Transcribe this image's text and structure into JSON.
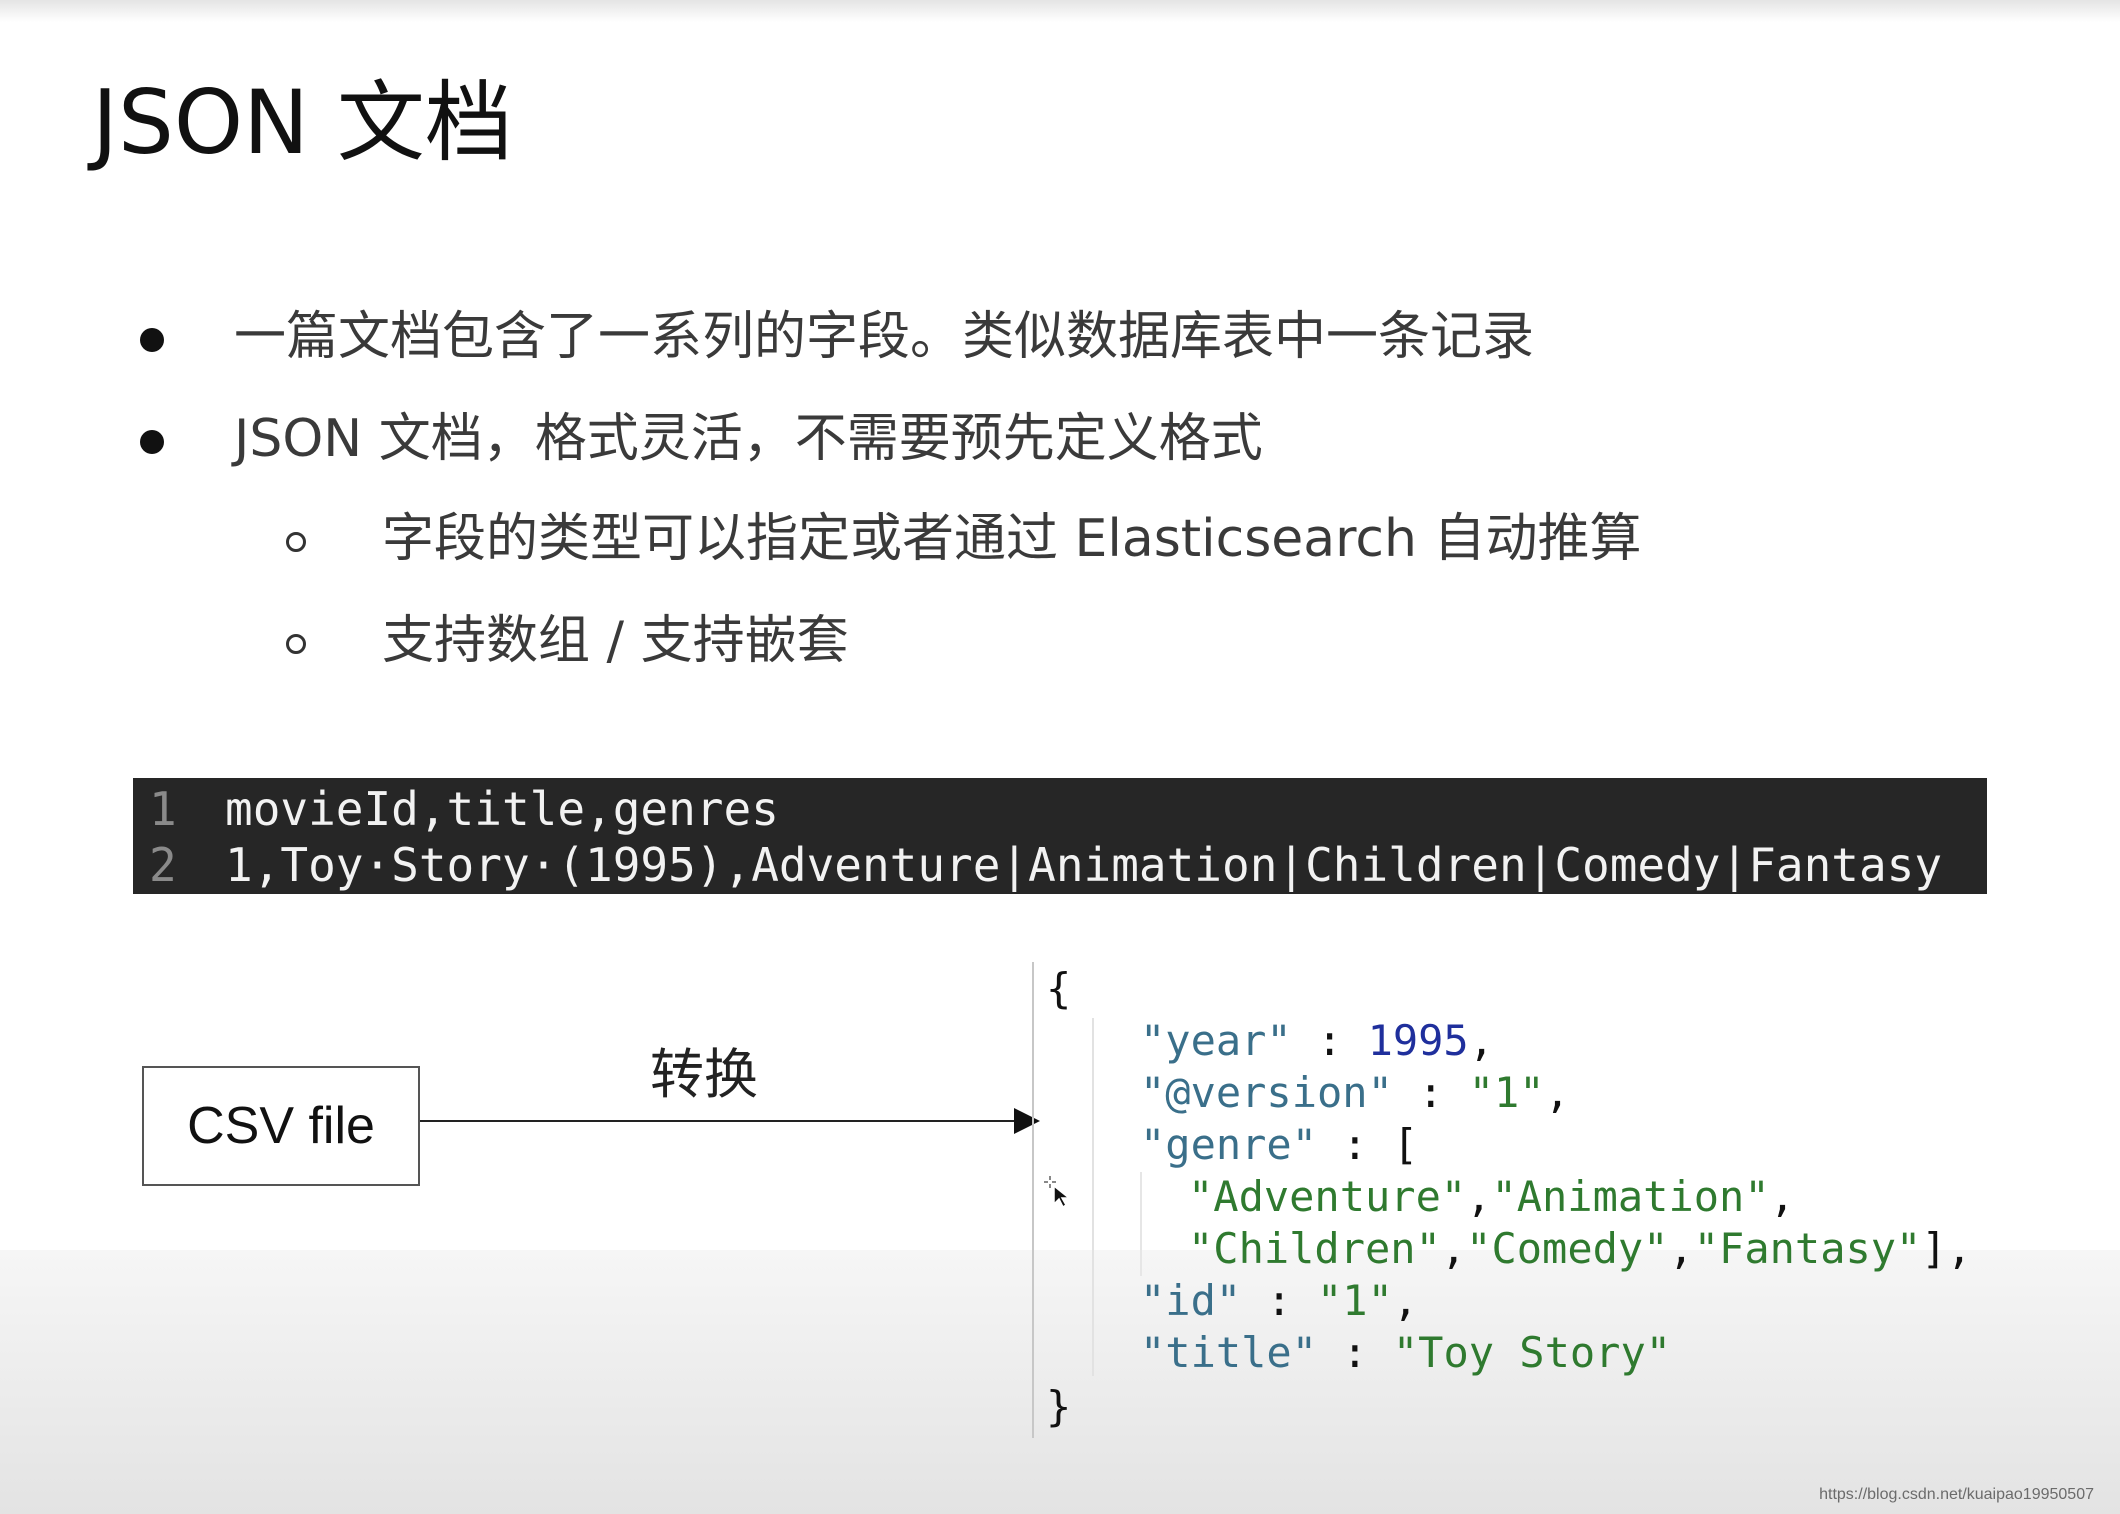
{
  "slide": {
    "title": "JSON 文档",
    "bullets": [
      "一篇文档包含了一系列的字段。类似数据库表中一条记录",
      "JSON 文档，格式灵活，不需要预先定义格式"
    ],
    "sub_bullets": [
      "字段的类型可以指定或者通过 Elasticsearch 自动推算",
      "支持数组 / 支持嵌套"
    ]
  },
  "csv_code": {
    "lines": [
      {
        "num": "1",
        "text": "movieId,title,genres"
      },
      {
        "num": "2",
        "text": "1,Toy·Story·(1995),Adventure|Animation|Children|Comedy|Fantasy"
      }
    ]
  },
  "diagram": {
    "source_label": "CSV file",
    "arrow_label": "转换"
  },
  "json_doc": {
    "open_brace": "{",
    "close_brace": "}",
    "year_key": "\"year\"",
    "year_value": "1995",
    "version_key": "\"@version\"",
    "version_value": "\"1\"",
    "genre_key": "\"genre\"",
    "genre_open": "[",
    "genre_close": "],",
    "genre_values": [
      "\"Adventure\"",
      "\"Animation\"",
      "\"Children\"",
      "\"Comedy\"",
      "\"Fantasy\""
    ],
    "id_key": "\"id\"",
    "id_value": "\"1\"",
    "title_key": "\"title\"",
    "title_value": "\"Toy Story\"",
    "colon": " : ",
    "comma": ","
  },
  "colors": {
    "code_bg": "#262626",
    "json_key": "#3a6f8a",
    "json_string": "#2f7a2f",
    "json_number": "#1f2f9c"
  },
  "watermark": "https://blog.csdn.net/kuaipao19950507",
  "icons": [
    "bullet-dot",
    "sub-bullet-circle",
    "arrow-right",
    "mouse-cursor-icon"
  ]
}
